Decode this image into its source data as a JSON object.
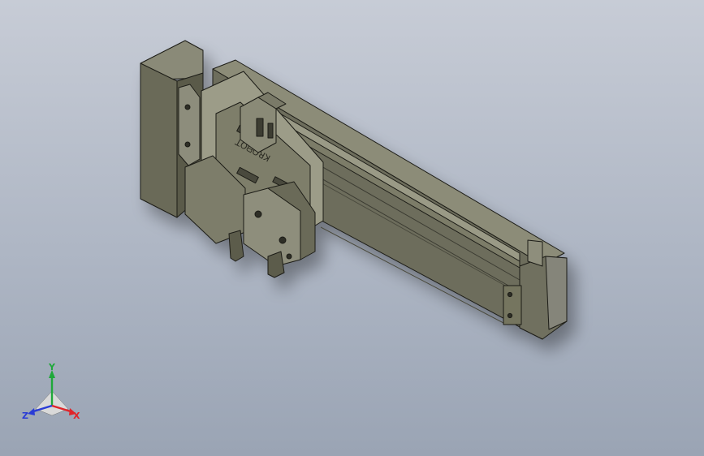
{
  "viewport": {
    "background_top": "#c7ccd6",
    "background_bottom": "#9aa4b4"
  },
  "model": {
    "logo_text": "ꓕOᗺOꓤꓘ"
  },
  "triad": {
    "x_label": "X",
    "y_label": "Y",
    "z_label": "Z",
    "x_color": "#e0252a",
    "y_color": "#1fa83a",
    "z_color": "#2a3cd6"
  }
}
